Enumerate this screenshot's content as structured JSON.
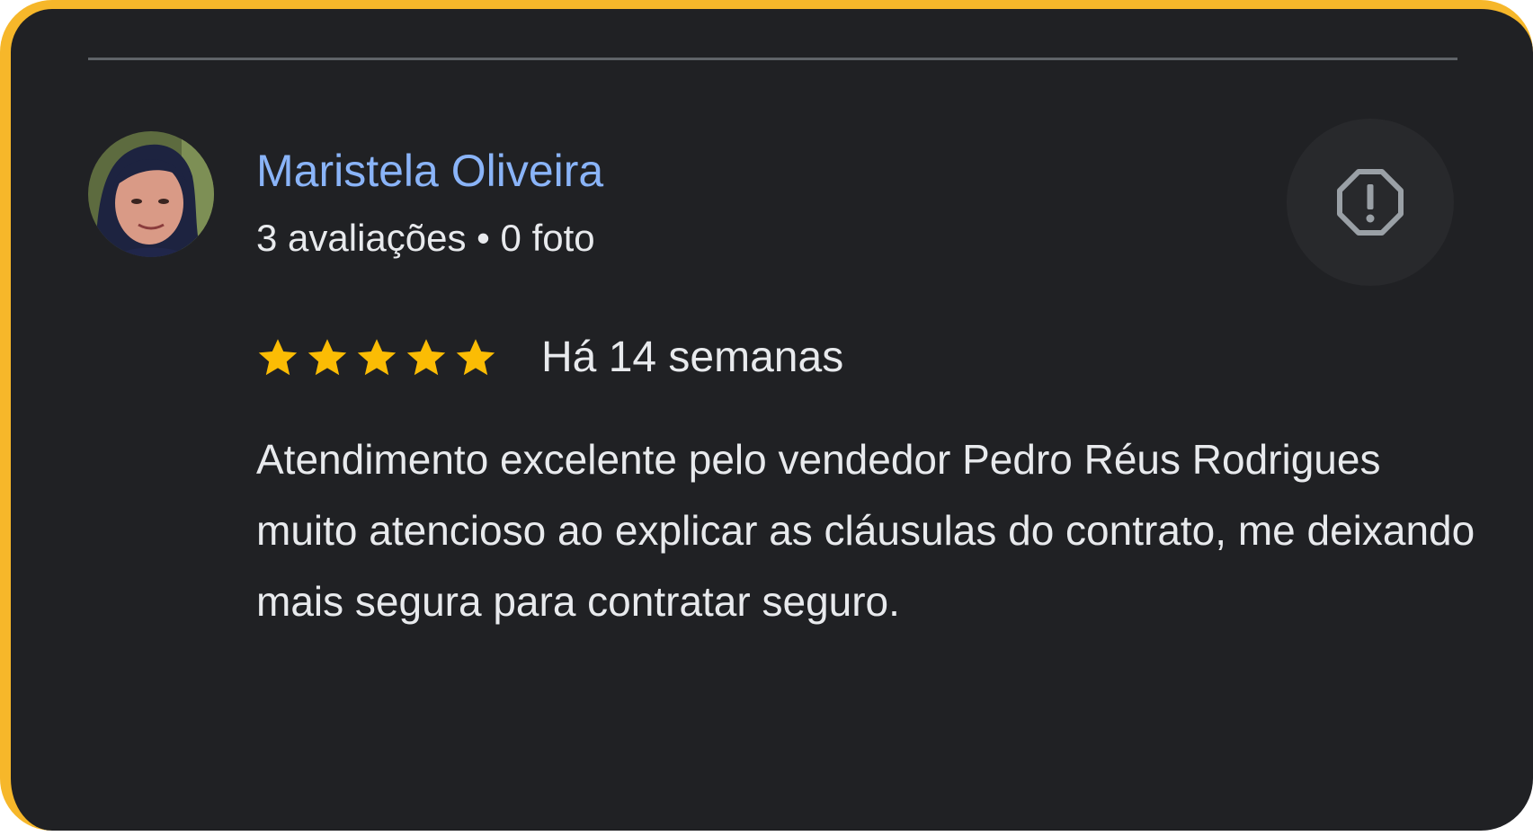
{
  "review": {
    "reviewer": {
      "name": "Maristela Oliveira",
      "reviews_count": "3 avaliações",
      "separator": "•",
      "photos_count": "0 foto",
      "avatar_icon": "reviewer-photo"
    },
    "rating": {
      "stars": 5,
      "max": 5,
      "date": "Há 14 semanas"
    },
    "text": "Atendimento excelente pelo vendedor Pedro Réus Rodrigues muito atencioso ao explicar as cláusulas do contrato, me deixando mais segura para contratar seguro.",
    "actions": {
      "report_icon": "report-octagon-icon"
    }
  },
  "colors": {
    "card_background": "#202124",
    "frame_accent": "#f6b72a",
    "name_link": "#8ab4f8",
    "text_primary": "#e8eaed",
    "star_filled": "#fbbc04",
    "icon_gray": "#9aa0a6",
    "divider": "#5f6368"
  }
}
